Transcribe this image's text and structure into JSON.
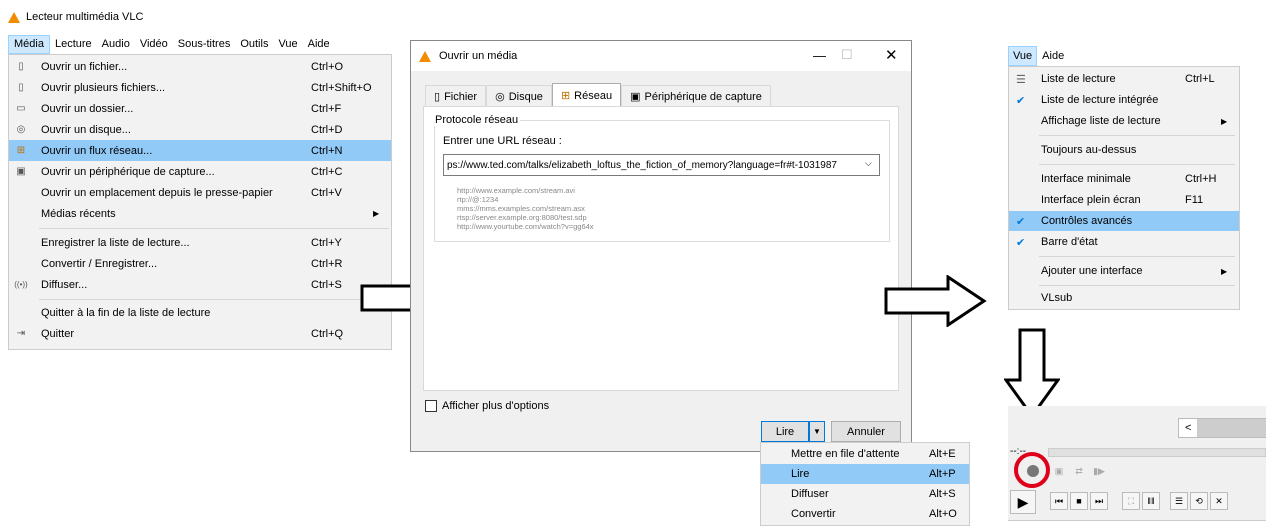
{
  "panel1": {
    "title": "Lecteur multimédia VLC",
    "menubar": [
      "Média",
      "Lecture",
      "Audio",
      "Vidéo",
      "Sous-titres",
      "Outils",
      "Vue",
      "Aide"
    ],
    "items": [
      {
        "label": "Ouvrir un fichier...",
        "shortcut": "Ctrl+O",
        "icon": "file-icon"
      },
      {
        "label": "Ouvrir plusieurs fichiers...",
        "shortcut": "Ctrl+Shift+O",
        "icon": "files-icon"
      },
      {
        "label": "Ouvrir un dossier...",
        "shortcut": "Ctrl+F",
        "icon": "folder-icon"
      },
      {
        "label": "Ouvrir un disque...",
        "shortcut": "Ctrl+D",
        "icon": "disc-icon"
      },
      {
        "label": "Ouvrir un flux réseau...",
        "shortcut": "Ctrl+N",
        "icon": "network-icon"
      },
      {
        "label": "Ouvrir un périphérique de capture...",
        "shortcut": "Ctrl+C",
        "icon": "capture-icon"
      },
      {
        "label": "Ouvrir un emplacement depuis le presse-papier",
        "shortcut": "Ctrl+V",
        "icon": ""
      },
      {
        "label": "Médias récents",
        "shortcut": "",
        "icon": ""
      },
      {
        "label": "Enregistrer la liste de lecture...",
        "shortcut": "Ctrl+Y",
        "icon": ""
      },
      {
        "label": "Convertir / Enregistrer...",
        "shortcut": "Ctrl+R",
        "icon": ""
      },
      {
        "label": "Diffuser...",
        "shortcut": "Ctrl+S",
        "icon": "stream-icon"
      },
      {
        "label": "Quitter à la fin de la liste de lecture",
        "shortcut": "",
        "icon": ""
      },
      {
        "label": "Quitter",
        "shortcut": "Ctrl+Q",
        "icon": "exit-icon"
      }
    ]
  },
  "dialog": {
    "title": "Ouvrir un média",
    "tabs": [
      "Fichier",
      "Disque",
      "Réseau",
      "Périphérique de capture"
    ],
    "group_title": "Protocole réseau",
    "url_label": "Entrer une URL réseau :",
    "url_value": "ps://www.ted.com/talks/elizabeth_loftus_the_fiction_of_memory?language=fr#t-1031987",
    "examples": [
      "http://www.example.com/stream.avi",
      "rtp://@:1234",
      "mms://mms.examples.com/stream.asx",
      "rtsp://server.example.org:8080/test.sdp",
      "http://www.yourtube.com/watch?v=gg64x"
    ],
    "more_options": "Afficher plus d'options",
    "play": "Lire",
    "cancel": "Annuler"
  },
  "dropdown": [
    {
      "label": "Mettre en file d'attente",
      "shortcut": "Alt+E"
    },
    {
      "label": "Lire",
      "shortcut": "Alt+P"
    },
    {
      "label": "Diffuser",
      "shortcut": "Alt+S"
    },
    {
      "label": "Convertir",
      "shortcut": "Alt+O"
    }
  ],
  "vue": {
    "menubar": [
      "Vue",
      "Aide"
    ],
    "items": [
      {
        "label": "Liste de lecture",
        "shortcut": "Ctrl+L"
      },
      {
        "label": "Liste de lecture intégrée",
        "shortcut": ""
      },
      {
        "label": "Affichage liste de lecture",
        "shortcut": ""
      },
      {
        "label": "Toujours au-dessus",
        "shortcut": ""
      },
      {
        "label": "Interface minimale",
        "shortcut": "Ctrl+H"
      },
      {
        "label": "Interface plein écran",
        "shortcut": "F11"
      },
      {
        "label": "Contrôles avancés",
        "shortcut": ""
      },
      {
        "label": "Barre d'état",
        "shortcut": ""
      },
      {
        "label": "Ajouter une interface",
        "shortcut": ""
      },
      {
        "label": "VLsub",
        "shortcut": ""
      }
    ]
  },
  "controls": {
    "time": "--:--",
    "scroll_left": "<"
  },
  "colors": {
    "highlight": "#91c9f7",
    "accent": "#0078d7",
    "record_circle": "#e0001a",
    "vlc_orange": "#f28c00"
  }
}
